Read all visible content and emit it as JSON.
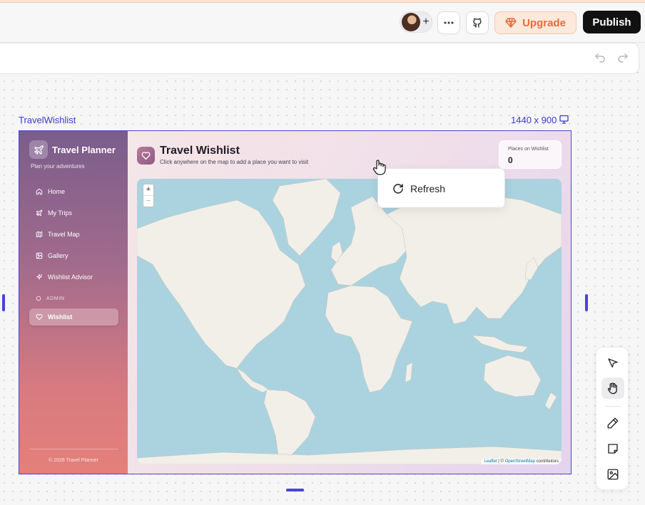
{
  "topbar": {
    "upgrade_label": "Upgrade",
    "publish_label": "Publish"
  },
  "canvas": {
    "frame_name": "TravelWishlist",
    "frame_size": "1440 x 900"
  },
  "app": {
    "brand_title": "Travel Planner",
    "brand_subtitle": "Plan your adventures",
    "nav": [
      {
        "label": "Home",
        "icon": "home-icon"
      },
      {
        "label": "My Trips",
        "icon": "plane-icon"
      },
      {
        "label": "Travel Map",
        "icon": "map-icon"
      },
      {
        "label": "Gallery",
        "icon": "gallery-icon"
      },
      {
        "label": "Wishlist Advisor",
        "icon": "sparkle-icon"
      },
      {
        "label": "ADMIN",
        "icon": "circle-icon"
      },
      {
        "label": "Wishlist",
        "icon": "heart-icon",
        "active": true
      }
    ],
    "footer": "© 2026 Travel Planner",
    "page_title": "Travel Wishlist",
    "page_subtitle": "Click anywhere on the map to add a place you want to visit",
    "stat_label": "Places on Wishlist",
    "stat_value": "0",
    "map": {
      "zoom_in": "+",
      "zoom_out": "−",
      "attribution_leaflet": "Leaflet",
      "attribution_sep": " | © ",
      "attribution_osm": "OpenStreetMap",
      "attribution_suffix": " contributors",
      "ocean_color": "#aad3df",
      "land_color": "#f2efe9"
    }
  },
  "context_menu": {
    "refresh_label": "Refresh"
  },
  "colors": {
    "accent": "#4a43d6",
    "upgrade": "#ea6b3a",
    "publish_bg": "#111111"
  }
}
